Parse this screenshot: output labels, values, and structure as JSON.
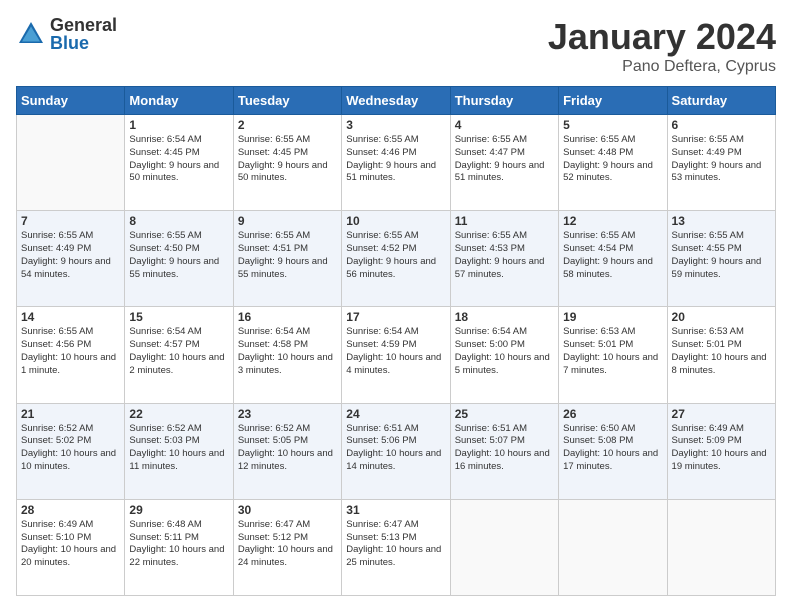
{
  "logo": {
    "general": "General",
    "blue": "Blue"
  },
  "title": {
    "main": "January 2024",
    "sub": "Pano Deftera, Cyprus"
  },
  "calendar": {
    "headers": [
      "Sunday",
      "Monday",
      "Tuesday",
      "Wednesday",
      "Thursday",
      "Friday",
      "Saturday"
    ],
    "weeks": [
      [
        {
          "day": "",
          "sunrise": "",
          "sunset": "",
          "daylight": "",
          "empty": true
        },
        {
          "day": "1",
          "sunrise": "Sunrise: 6:54 AM",
          "sunset": "Sunset: 4:45 PM",
          "daylight": "Daylight: 9 hours and 50 minutes."
        },
        {
          "day": "2",
          "sunrise": "Sunrise: 6:55 AM",
          "sunset": "Sunset: 4:45 PM",
          "daylight": "Daylight: 9 hours and 50 minutes."
        },
        {
          "day": "3",
          "sunrise": "Sunrise: 6:55 AM",
          "sunset": "Sunset: 4:46 PM",
          "daylight": "Daylight: 9 hours and 51 minutes."
        },
        {
          "day": "4",
          "sunrise": "Sunrise: 6:55 AM",
          "sunset": "Sunset: 4:47 PM",
          "daylight": "Daylight: 9 hours and 51 minutes."
        },
        {
          "day": "5",
          "sunrise": "Sunrise: 6:55 AM",
          "sunset": "Sunset: 4:48 PM",
          "daylight": "Daylight: 9 hours and 52 minutes."
        },
        {
          "day": "6",
          "sunrise": "Sunrise: 6:55 AM",
          "sunset": "Sunset: 4:49 PM",
          "daylight": "Daylight: 9 hours and 53 minutes."
        }
      ],
      [
        {
          "day": "7",
          "sunrise": "Sunrise: 6:55 AM",
          "sunset": "Sunset: 4:49 PM",
          "daylight": "Daylight: 9 hours and 54 minutes."
        },
        {
          "day": "8",
          "sunrise": "Sunrise: 6:55 AM",
          "sunset": "Sunset: 4:50 PM",
          "daylight": "Daylight: 9 hours and 55 minutes."
        },
        {
          "day": "9",
          "sunrise": "Sunrise: 6:55 AM",
          "sunset": "Sunset: 4:51 PM",
          "daylight": "Daylight: 9 hours and 55 minutes."
        },
        {
          "day": "10",
          "sunrise": "Sunrise: 6:55 AM",
          "sunset": "Sunset: 4:52 PM",
          "daylight": "Daylight: 9 hours and 56 minutes."
        },
        {
          "day": "11",
          "sunrise": "Sunrise: 6:55 AM",
          "sunset": "Sunset: 4:53 PM",
          "daylight": "Daylight: 9 hours and 57 minutes."
        },
        {
          "day": "12",
          "sunrise": "Sunrise: 6:55 AM",
          "sunset": "Sunset: 4:54 PM",
          "daylight": "Daylight: 9 hours and 58 minutes."
        },
        {
          "day": "13",
          "sunrise": "Sunrise: 6:55 AM",
          "sunset": "Sunset: 4:55 PM",
          "daylight": "Daylight: 9 hours and 59 minutes."
        }
      ],
      [
        {
          "day": "14",
          "sunrise": "Sunrise: 6:55 AM",
          "sunset": "Sunset: 4:56 PM",
          "daylight": "Daylight: 10 hours and 1 minute."
        },
        {
          "day": "15",
          "sunrise": "Sunrise: 6:54 AM",
          "sunset": "Sunset: 4:57 PM",
          "daylight": "Daylight: 10 hours and 2 minutes."
        },
        {
          "day": "16",
          "sunrise": "Sunrise: 6:54 AM",
          "sunset": "Sunset: 4:58 PM",
          "daylight": "Daylight: 10 hours and 3 minutes."
        },
        {
          "day": "17",
          "sunrise": "Sunrise: 6:54 AM",
          "sunset": "Sunset: 4:59 PM",
          "daylight": "Daylight: 10 hours and 4 minutes."
        },
        {
          "day": "18",
          "sunrise": "Sunrise: 6:54 AM",
          "sunset": "Sunset: 5:00 PM",
          "daylight": "Daylight: 10 hours and 5 minutes."
        },
        {
          "day": "19",
          "sunrise": "Sunrise: 6:53 AM",
          "sunset": "Sunset: 5:01 PM",
          "daylight": "Daylight: 10 hours and 7 minutes."
        },
        {
          "day": "20",
          "sunrise": "Sunrise: 6:53 AM",
          "sunset": "Sunset: 5:01 PM",
          "daylight": "Daylight: 10 hours and 8 minutes."
        }
      ],
      [
        {
          "day": "21",
          "sunrise": "Sunrise: 6:52 AM",
          "sunset": "Sunset: 5:02 PM",
          "daylight": "Daylight: 10 hours and 10 minutes."
        },
        {
          "day": "22",
          "sunrise": "Sunrise: 6:52 AM",
          "sunset": "Sunset: 5:03 PM",
          "daylight": "Daylight: 10 hours and 11 minutes."
        },
        {
          "day": "23",
          "sunrise": "Sunrise: 6:52 AM",
          "sunset": "Sunset: 5:05 PM",
          "daylight": "Daylight: 10 hours and 12 minutes."
        },
        {
          "day": "24",
          "sunrise": "Sunrise: 6:51 AM",
          "sunset": "Sunset: 5:06 PM",
          "daylight": "Daylight: 10 hours and 14 minutes."
        },
        {
          "day": "25",
          "sunrise": "Sunrise: 6:51 AM",
          "sunset": "Sunset: 5:07 PM",
          "daylight": "Daylight: 10 hours and 16 minutes."
        },
        {
          "day": "26",
          "sunrise": "Sunrise: 6:50 AM",
          "sunset": "Sunset: 5:08 PM",
          "daylight": "Daylight: 10 hours and 17 minutes."
        },
        {
          "day": "27",
          "sunrise": "Sunrise: 6:49 AM",
          "sunset": "Sunset: 5:09 PM",
          "daylight": "Daylight: 10 hours and 19 minutes."
        }
      ],
      [
        {
          "day": "28",
          "sunrise": "Sunrise: 6:49 AM",
          "sunset": "Sunset: 5:10 PM",
          "daylight": "Daylight: 10 hours and 20 minutes."
        },
        {
          "day": "29",
          "sunrise": "Sunrise: 6:48 AM",
          "sunset": "Sunset: 5:11 PM",
          "daylight": "Daylight: 10 hours and 22 minutes."
        },
        {
          "day": "30",
          "sunrise": "Sunrise: 6:47 AM",
          "sunset": "Sunset: 5:12 PM",
          "daylight": "Daylight: 10 hours and 24 minutes."
        },
        {
          "day": "31",
          "sunrise": "Sunrise: 6:47 AM",
          "sunset": "Sunset: 5:13 PM",
          "daylight": "Daylight: 10 hours and 25 minutes."
        },
        {
          "day": "",
          "sunrise": "",
          "sunset": "",
          "daylight": "",
          "empty": true
        },
        {
          "day": "",
          "sunrise": "",
          "sunset": "",
          "daylight": "",
          "empty": true
        },
        {
          "day": "",
          "sunrise": "",
          "sunset": "",
          "daylight": "",
          "empty": true
        }
      ]
    ]
  }
}
